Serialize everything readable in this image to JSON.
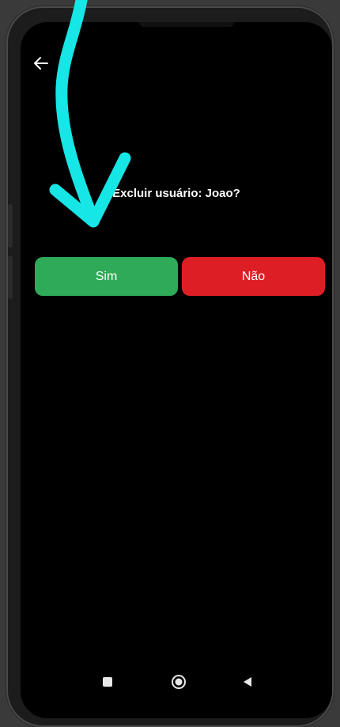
{
  "dialog": {
    "question": "Excluir usuário: Joao?",
    "yes_label": "Sim",
    "no_label": "Não"
  },
  "colors": {
    "yes": "#2eaa59",
    "no": "#dd1f25",
    "annotation_arrow": "#16e6e6",
    "screen_bg": "#000000"
  },
  "icons": {
    "top_back": "back-arrow-icon",
    "nav_recent": "square-icon",
    "nav_home": "circle-icon",
    "nav_back": "triangle-back-icon",
    "annotation": "cyan-curved-arrow-icon"
  }
}
